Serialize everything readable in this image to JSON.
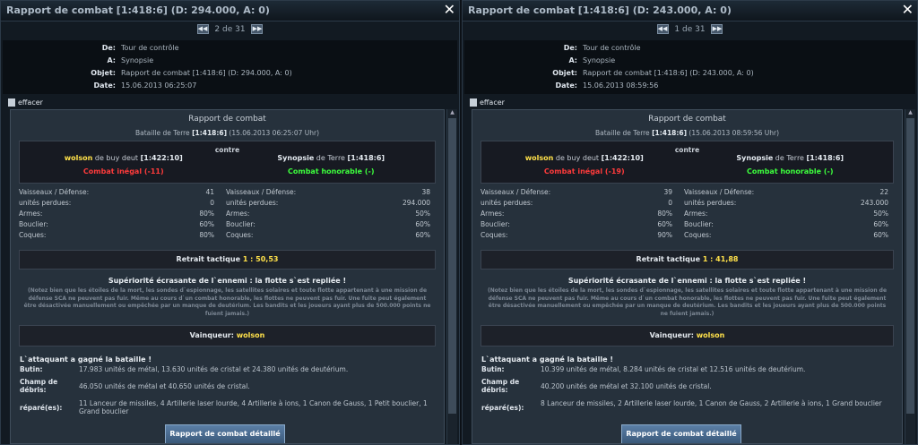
{
  "windows": [
    {
      "title": "Rapport de combat [1:418:6] (D: 294.000, A: 0)",
      "pager": "2 de 31",
      "header": {
        "de_label": "De:",
        "de": "Tour de contrôle",
        "a_label": "A:",
        "a": "Synopsie",
        "objet_label": "Objet:",
        "objet": "Rapport de combat [1:418:6] (D: 294.000, A: 0)",
        "date_label": "Date:",
        "date": "15.06.2013 06:25:07"
      },
      "delete_label": "effacer",
      "report": {
        "title": "Rapport de combat",
        "battle_prefix": "Bataille de Terre",
        "battle_coords": "[1:418:6]",
        "battle_time": "(15.06.2013 06:25:07 Uhr)",
        "contre": "contre",
        "attacker": {
          "name": "wolson",
          "from": "de buy deut",
          "coords": "[1:422:10]",
          "status": "Combat inégal (-11)"
        },
        "defender": {
          "name": "Synopsie",
          "from": "de Terre",
          "coords": "[1:418:6]",
          "status": "Combat honorable (-)"
        },
        "att_stats": [
          {
            "label": "Vaisseaux / Défense:",
            "value": "41"
          },
          {
            "label": "unités perdues:",
            "value": "0"
          },
          {
            "label": "Armes:",
            "value": "80%"
          },
          {
            "label": "Bouclier:",
            "value": "60%"
          },
          {
            "label": "Coques:",
            "value": "80%"
          }
        ],
        "def_stats": [
          {
            "label": "Vaisseaux / Défense:",
            "value": "38"
          },
          {
            "label": "unités perdues:",
            "value": "294.000"
          },
          {
            "label": "Armes:",
            "value": "50%"
          },
          {
            "label": "Bouclier:",
            "value": "60%"
          },
          {
            "label": "Coques:",
            "value": "60%"
          }
        ],
        "retrait_label": "Retrait tactique",
        "retrait_value": "1 : 50,53",
        "superiority": "Supériorité écrasante de l`ennemi : la flotte s`est repliée !",
        "note": "(Notez bien que les étoiles de la mort, les sondes d`espionnage, les satellites solaires et toute flotte appartenant à une mission de défense SCA ne peuvent pas fuir. Même au cours d`un combat honorable, les flottes ne peuvent pas fuir. Une fuite peut également être désactivée manuellement ou empêchée par un manque de deutérium. Les bandits et les joueurs ayant plus de 500.000 points ne fuient jamais.)",
        "winner_label": "Vainqueur:",
        "winner": "wolson",
        "won_text": "L`attaquant a gagné la bataille !",
        "butin_label": "Butin:",
        "butin": "17.983 unités de métal, 13.630 unités de cristal et 24.380 unités de deutérium.",
        "debris_label": "Champ de débris:",
        "debris": "46.050 unités de métal et 40.650 unités de cristal.",
        "repaired_label": "réparé(es):",
        "repaired": "11 Lanceur de missiles, 4 Artillerie laser lourde, 4 Artillerie à ions, 1 Canon de Gauss, 1 Petit bouclier, 1 Grand bouclier",
        "detail_button": "Rapport de combat détaillé"
      }
    },
    {
      "title": "Rapport de combat [1:418:6] (D: 243.000, A: 0)",
      "pager": "1 de 31",
      "header": {
        "de_label": "De:",
        "de": "Tour de contrôle",
        "a_label": "A:",
        "a": "Synopsie",
        "objet_label": "Objet:",
        "objet": "Rapport de combat [1:418:6] (D: 243.000, A: 0)",
        "date_label": "Date:",
        "date": "15.06.2013 08:59:56"
      },
      "delete_label": "effacer",
      "report": {
        "title": "Rapport de combat",
        "battle_prefix": "Bataille de Terre",
        "battle_coords": "[1:418:6]",
        "battle_time": "(15.06.2013 08:59:56 Uhr)",
        "contre": "contre",
        "attacker": {
          "name": "wolson",
          "from": "de buy deut",
          "coords": "[1:422:10]",
          "status": "Combat inégal (-19)"
        },
        "defender": {
          "name": "Synopsie",
          "from": "de Terre",
          "coords": "[1:418:6]",
          "status": "Combat honorable (-)"
        },
        "att_stats": [
          {
            "label": "Vaisseaux / Défense:",
            "value": "39"
          },
          {
            "label": "unités perdues:",
            "value": "0"
          },
          {
            "label": "Armes:",
            "value": "80%"
          },
          {
            "label": "Bouclier:",
            "value": "60%"
          },
          {
            "label": "Coques:",
            "value": "90%"
          }
        ],
        "def_stats": [
          {
            "label": "Vaisseaux / Défense:",
            "value": "22"
          },
          {
            "label": "unités perdues:",
            "value": "243.000"
          },
          {
            "label": "Armes:",
            "value": "50%"
          },
          {
            "label": "Bouclier:",
            "value": "60%"
          },
          {
            "label": "Coques:",
            "value": "60%"
          }
        ],
        "retrait_label": "Retrait tactique",
        "retrait_value": "1 : 41,88",
        "superiority": "Supériorité écrasante de l`ennemi : la flotte s`est repliée !",
        "note": "(Notez bien que les étoiles de la mort, les sondes d`espionnage, les satellites solaires et toute flotte appartenant à une mission de défense SCA ne peuvent pas fuir. Même au cours d`un combat honorable, les flottes ne peuvent pas fuir. Une fuite peut également être désactivée manuellement ou empêchée par un manque de deutérium. Les bandits et les joueurs ayant plus de 500.000 points ne fuient jamais.)",
        "winner_label": "Vainqueur:",
        "winner": "wolson",
        "won_text": "L`attaquant a gagné la bataille !",
        "butin_label": "Butin:",
        "butin": "10.399 unités de métal, 8.284 unités de cristal et 12.516 unités de deutérium.",
        "debris_label": "Champ de débris:",
        "debris": "40.200 unités de métal et 32.100 unités de cristal.",
        "repaired_label": "réparé(es):",
        "repaired": "8 Lanceur de missiles, 2 Artillerie laser lourde, 1 Canon de Gauss, 2 Artillerie à ions, 1 Grand bouclier",
        "detail_button": "Rapport de combat détaillé"
      }
    }
  ],
  "icons": {
    "close": "close-icon",
    "prev": "prev-page-icon",
    "next": "next-page-icon",
    "trash": "trash-icon"
  }
}
